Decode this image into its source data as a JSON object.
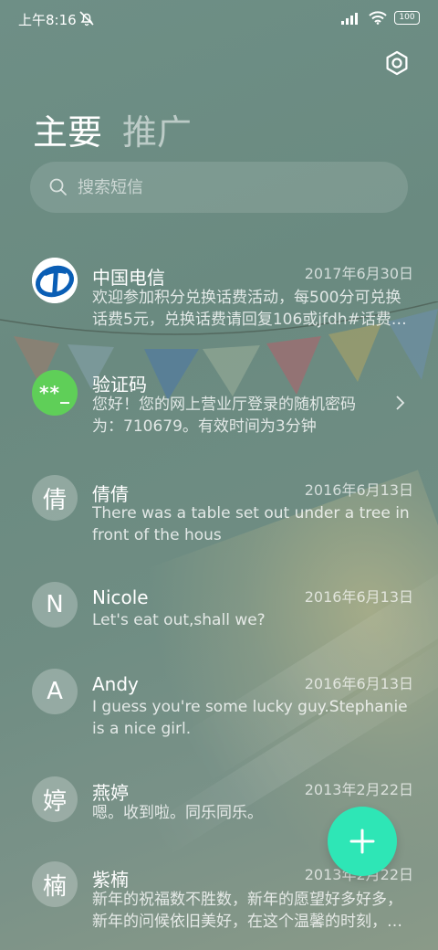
{
  "status_bar": {
    "time": "上午8:16",
    "battery": "100"
  },
  "tabs": [
    {
      "label": "主要"
    },
    {
      "label": "推广"
    }
  ],
  "search": {
    "placeholder": "搜索短信"
  },
  "messages": [
    {
      "name": "中国电信",
      "date": "2017年6月30日",
      "preview": "欢迎参加积分兑换话费活动，每500分可兑换话费5元，兑换话费请回复106或jfdh#话费…"
    },
    {
      "name": "验证码",
      "date": "",
      "avatar_text": "**_",
      "preview": "您好！您的网上营业厅登录的随机密码为：710679。有效时间为3分钟"
    },
    {
      "name": "倩倩",
      "date": "2016年6月13日",
      "avatar_text": "倩",
      "preview": "There was a table set out under a tree in front of the hous"
    },
    {
      "name": "Nicole",
      "date": "2016年6月13日",
      "avatar_text": "N",
      "preview": "Let's eat out,shall we?"
    },
    {
      "name": "Andy",
      "date": "2016年6月13日",
      "avatar_text": "A",
      "preview": "I guess you're some lucky guy.Stephanie is a nice girl."
    },
    {
      "name": "燕婷",
      "date": "2013年2月22日",
      "avatar_text": "婷",
      "preview": "嗯。收到啦。同乐同乐。"
    },
    {
      "name": "紫楠",
      "date": "2013年2月22日",
      "avatar_text": "楠",
      "preview": "新年的祝福数不胜数，新年的愿望好多好多，新年的问候依旧美好，在这个温馨的时刻，…"
    }
  ],
  "colors": {
    "accent": "#2ee6b6",
    "code_avatar": "#5fcf58",
    "telecom_blue": "#0a5eb5"
  },
  "icons": {
    "settings": "hexagon-gear-icon",
    "search": "search-icon",
    "fab": "plus-icon",
    "chevron": "chevron-right-icon",
    "mute": "notification-off-icon"
  }
}
